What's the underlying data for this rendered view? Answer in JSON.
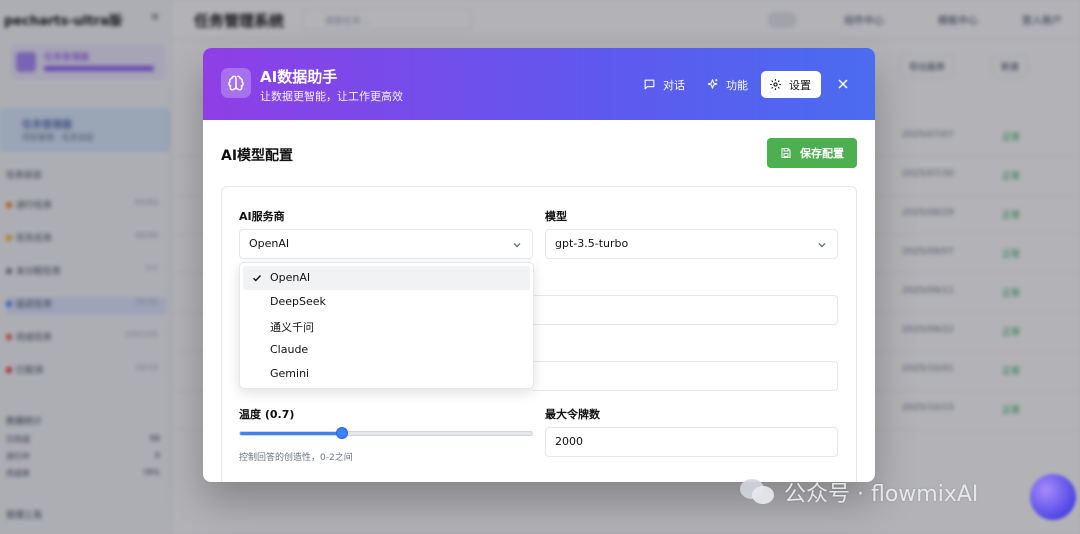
{
  "background": {
    "sidebar_brand": "pecharts-ultra版",
    "page_title": "任务管理系统",
    "search_placeholder": "搜索任务...",
    "top_links": [
      "组件中心",
      "模板中心",
      "登入账户"
    ],
    "active_item": {
      "title": "任务管理器",
      "sub": "项目管理 · 任务追踪"
    },
    "section_label": "任务状态",
    "rows": [
      {
        "label": "进行任务",
        "val": "83/83"
      },
      {
        "label": "优先任务",
        "val": "49/49"
      },
      {
        "label": "未分配任务",
        "val": "7/7"
      },
      {
        "label": "延迟任务",
        "val": "31/31"
      },
      {
        "label": "完成任务",
        "val": "155/155"
      },
      {
        "label": "已取消",
        "val": "10/10"
      }
    ],
    "stats_label": "数据统计",
    "stats": [
      {
        "label": "已完成",
        "val": "88"
      },
      {
        "label": "进行中",
        "val": "8"
      },
      {
        "label": "完成率",
        "val": "78%"
      }
    ],
    "footer_label": "管理工具",
    "table_dates": [
      "2025/07/07",
      "2025/07/30",
      "2025/08/29",
      "2025/09/07",
      "2025/09/11",
      "2025/09/22",
      "2025/10/01",
      "2025/10/15"
    ],
    "table_status": "正常",
    "buttons": [
      "导出报表",
      "新建"
    ]
  },
  "modal": {
    "title": "AI数据助手",
    "subtitle": "让数据更智能，让工作更高效",
    "tabs": [
      {
        "label": "对话",
        "icon": "chat-icon",
        "active": false
      },
      {
        "label": "功能",
        "icon": "sparkle-icon",
        "active": false
      },
      {
        "label": "设置",
        "icon": "gear-icon",
        "active": true
      }
    ],
    "section_title": "AI模型配置",
    "save_label": "保存配置",
    "provider_label": "AI服务商",
    "provider_value": "OpenAI",
    "model_label": "模型",
    "model_value": "gpt-3.5-turbo",
    "provider_options": [
      "OpenAI",
      "DeepSeek",
      "通义千问",
      "Claude",
      "Gemini"
    ],
    "selected_option": "OpenAI",
    "temperature_label": "温度 (0.7)",
    "temperature_value": 0.7,
    "temperature_max": 2,
    "temperature_hint": "控制回答的创造性，0-2之间",
    "max_tokens_label": "最大令牌数",
    "max_tokens_value": "2000"
  },
  "watermark": {
    "text": "公众号 · flowmixAI"
  },
  "colors": {
    "header_start": "#8e3fe6",
    "header_end": "#4a6cf0",
    "save_button": "#4caf50",
    "slider": "#3b82f6"
  }
}
